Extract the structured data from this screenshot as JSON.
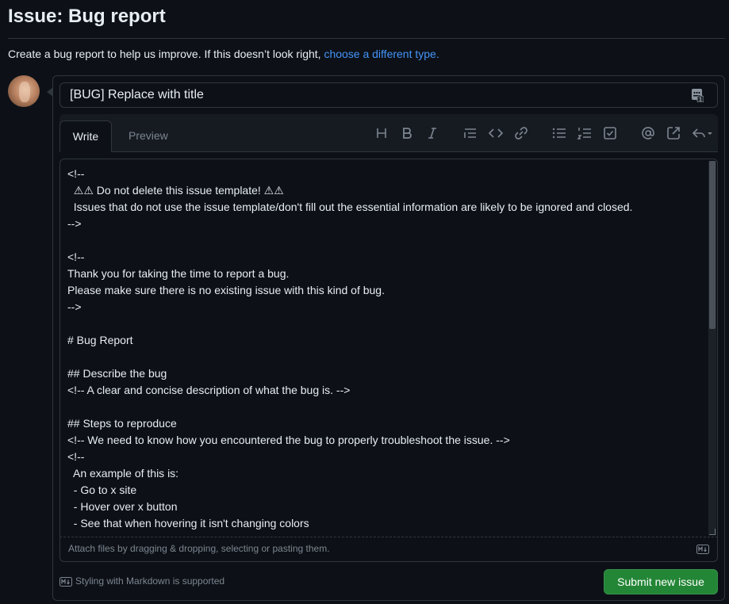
{
  "page": {
    "title": "Issue: Bug report",
    "subtitle_text": "Create a bug report to help us improve. If this doesn’t look right, ",
    "subtitle_link": "choose a different type."
  },
  "form": {
    "title_value": "[BUG] Replace with title",
    "tabs": {
      "write": "Write",
      "preview": "Preview"
    },
    "toolbar": [
      "heading-icon",
      "bold-icon",
      "italic-icon",
      "quote-icon",
      "code-icon",
      "link-icon",
      "unordered-list-icon",
      "ordered-list-icon",
      "task-list-icon",
      "mention-icon",
      "reference-icon",
      "saved-replies-icon"
    ],
    "body_lines": [
      "<!--",
      "  ⚠⚠ Do not delete this issue template! ⚠⚠",
      "  Issues that do not use the issue template/don't fill out the essential information are likely to be ignored and closed.",
      "-->",
      "",
      "<!--",
      "Thank you for taking the time to report a bug.",
      "Please make sure there is no existing issue with this kind of bug.",
      "-->",
      "",
      "# Bug Report",
      "",
      "## Describe the bug",
      "<!-- A clear and concise description of what the bug is. -->",
      "",
      "## Steps to reproduce",
      "<!-- We need to know how you encountered the bug to properly troubleshoot the issue. -->",
      "<!--",
      "  An example of this is:",
      "  - Go to x site",
      "  - Hover over x button",
      "  - See that when hovering it isn't changing colors"
    ],
    "attach_text": "Attach files by dragging & dropping, selecting or pasting them.",
    "markdown_note": "Styling with Markdown is supported",
    "submit_label": "Submit new issue"
  },
  "colors": {
    "background": "#0d1117",
    "link": "#4493f8",
    "submit": "#238636",
    "border": "#30363d"
  }
}
